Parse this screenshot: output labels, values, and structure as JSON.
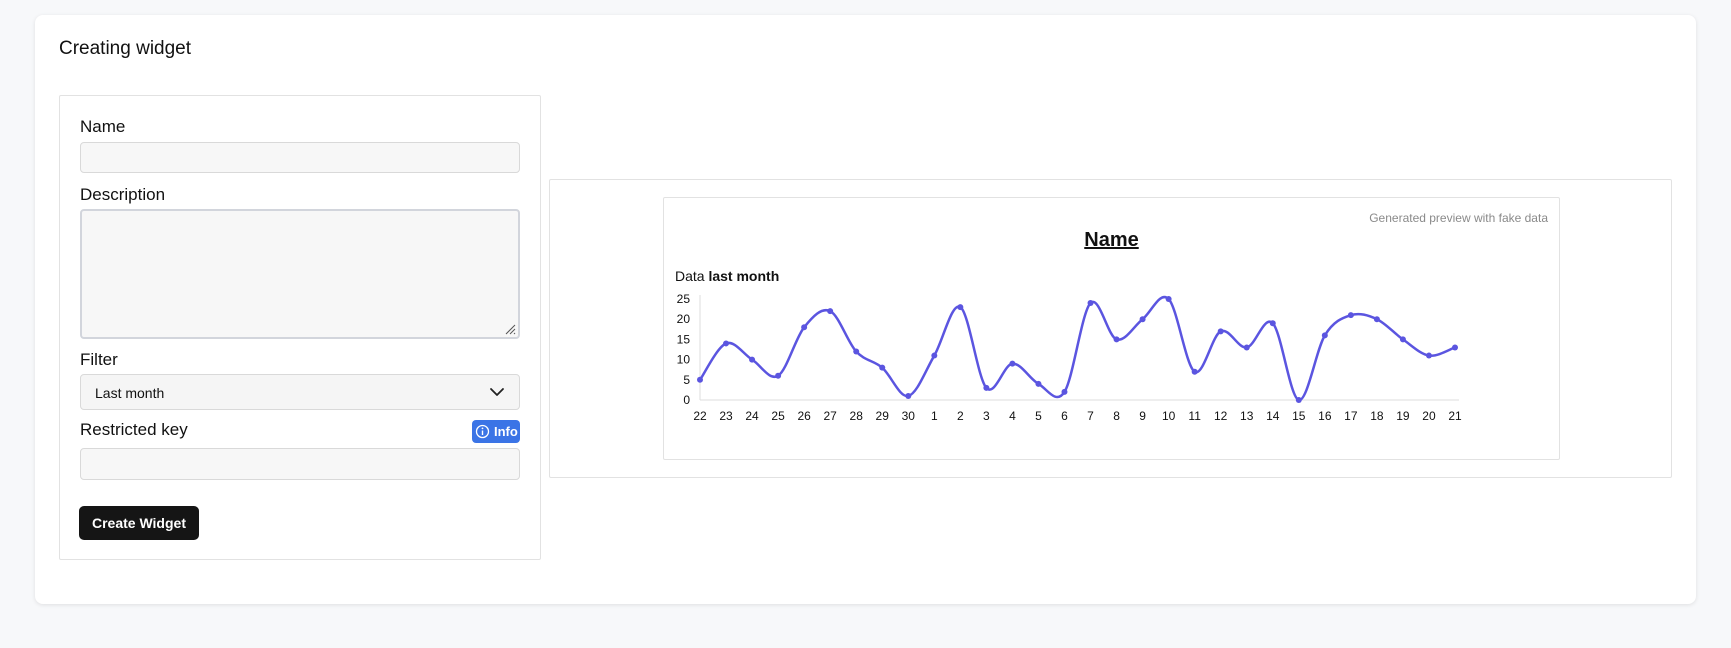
{
  "page": {
    "title": "Creating widget"
  },
  "form": {
    "name_label": "Name",
    "name_value": "",
    "description_label": "Description",
    "description_value": "",
    "filter_label": "Filter",
    "filter_selected": "Last month",
    "restricted_key_label": "Restricted key",
    "restricted_key_value": "",
    "info_badge_label": "Info",
    "create_button_label": "Create Widget"
  },
  "preview": {
    "note": "Generated preview with fake data",
    "title": "Name",
    "subtitle_prefix": "Data",
    "subtitle_period": "last month"
  },
  "colors": {
    "line": "#5b55e0",
    "button": "#151515",
    "info_badge": "#3b74e6"
  },
  "chart_data": {
    "type": "line",
    "title": "Name",
    "categories": [
      "22",
      "23",
      "24",
      "25",
      "26",
      "27",
      "28",
      "29",
      "30",
      "1",
      "2",
      "3",
      "4",
      "5",
      "6",
      "7",
      "8",
      "9",
      "10",
      "11",
      "12",
      "13",
      "14",
      "15",
      "16",
      "17",
      "18",
      "19",
      "20",
      "21"
    ],
    "series": [
      {
        "values": [
          5,
          14,
          10,
          6,
          18,
          22,
          12,
          8,
          1,
          11,
          23,
          3,
          9,
          4,
          2,
          24,
          15,
          20,
          25,
          7,
          17,
          13,
          19,
          0,
          16,
          21,
          20,
          15,
          11,
          13
        ]
      }
    ],
    "yticks": [
      0,
      5,
      10,
      15,
      20,
      25
    ],
    "ylim": [
      0,
      25
    ],
    "grid": false,
    "legend": "none",
    "smooth": true,
    "show_points": true
  }
}
